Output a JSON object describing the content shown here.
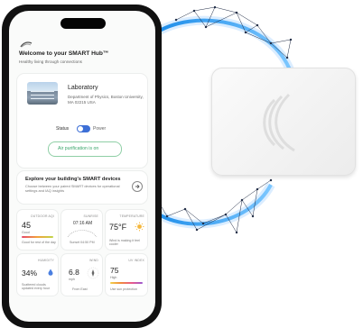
{
  "app": {
    "welcome": "Welcome to your SMART Hub™",
    "tagline": "Healthy living through connections"
  },
  "room": {
    "name": "Laboratory",
    "address": "Department of Physics, Boston University, MA 02215 USA",
    "status_label": "Status",
    "power_label": "Power",
    "purification": "Air purification is on"
  },
  "explore": {
    "title": "Explore your building's SMART devices",
    "desc": "Choose between your paired SMART devices for operational settings and IAQ insights"
  },
  "tiles": [
    {
      "label": "OUTDOOR AQI",
      "value": "45",
      "sub": "Good",
      "note": "Good for rest of the day",
      "color": "#e5486b"
    },
    {
      "label": "SUNRISE",
      "value": "07:16 AM",
      "sub": "",
      "note": "Sunset 04:50 PM",
      "color": ""
    },
    {
      "label": "TEMPERATURE",
      "value": "75°F",
      "sub": "",
      "note": "Wind is making it feel cooler",
      "color": "#f5b73c"
    },
    {
      "label": "HUMIDITY",
      "value": "34%",
      "sub": "",
      "note": "Scattered clouds updated every hour",
      "color": "#4a7fe0"
    },
    {
      "label": "WIND",
      "value": "6.8",
      "sub": "mph",
      "note": "From East",
      "color": ""
    },
    {
      "label": "UV INDEX",
      "value": "75",
      "sub": "High",
      "note": "Use sun protection",
      "color": "#e85a8c"
    }
  ],
  "colors": {
    "accent_green": "#3aa66a",
    "toggle_blue": "#3d6fd6",
    "glow_blue": "#2f95ee"
  }
}
